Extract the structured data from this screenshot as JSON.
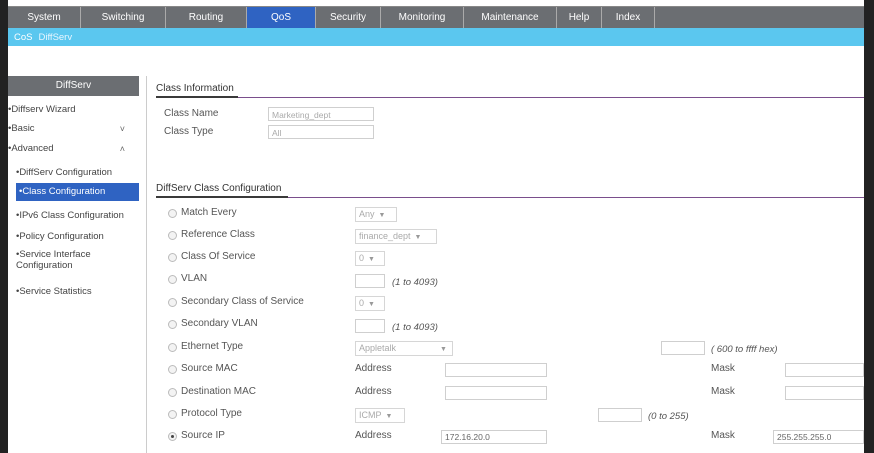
{
  "topnav": {
    "tabs": [
      "System",
      "Switching",
      "Routing",
      "QoS",
      "Security",
      "Monitoring",
      "Maintenance",
      "Help",
      "Index"
    ],
    "active": "QoS"
  },
  "subnav": {
    "items": [
      "CoS",
      "DiffServ"
    ],
    "active": "DiffServ"
  },
  "sidebar": {
    "title": "DiffServ",
    "items": [
      {
        "label": "•Diffserv Wizard"
      },
      {
        "label": "•Basic",
        "chevron": "˅"
      },
      {
        "label": "•Advanced",
        "chevron": "˄"
      },
      {
        "label": "•DiffServ Configuration"
      },
      {
        "label": "•Class Configuration"
      },
      {
        "label": "•IPv6 Class Configuration"
      },
      {
        "label": "•Policy Configuration"
      },
      {
        "label": "•Service Interface Configuration"
      },
      {
        "label": "•Service Statistics"
      }
    ],
    "active": "Class Configuration"
  },
  "class_info": {
    "title": "Class Information",
    "name_label": "Class Name",
    "name_value": "Marketing_dept",
    "type_label": "Class Type",
    "type_value": "All"
  },
  "config": {
    "title": "DiffServ Class Configuration",
    "rows": [
      {
        "label": "Match Every",
        "select": "Any"
      },
      {
        "label": "Reference Class",
        "select": "finance_dept"
      },
      {
        "label": "Class Of Service",
        "select": "0"
      },
      {
        "label": "VLAN",
        "hint": "(1 to 4093)"
      },
      {
        "label": "Secondary Class of Service",
        "select": "0"
      },
      {
        "label": "Secondary VLAN",
        "hint": "(1 to 4093)"
      },
      {
        "label": "Ethernet Type",
        "select": "Appletalk",
        "hint": "( 600 to ffff hex)"
      },
      {
        "label": "Source MAC",
        "addr_label": "Address",
        "mask_label": "Mask"
      },
      {
        "label": "Destination MAC",
        "addr_label": "Address",
        "mask_label": "Mask"
      },
      {
        "label": "Protocol Type",
        "select": "ICMP",
        "hint": "(0 to 255)"
      },
      {
        "label": "Source IP",
        "addr_label": "Address",
        "addr_value": "172.16.20.0",
        "mask_label": "Mask",
        "mask_value": "255.255.255.0",
        "selected": true
      }
    ]
  }
}
